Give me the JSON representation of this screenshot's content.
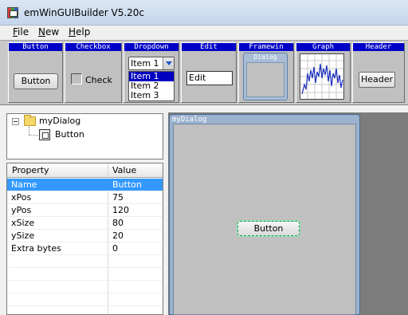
{
  "window": {
    "title": "emWinGUIBuilder V5.20c"
  },
  "menu": [
    {
      "label": "File",
      "accel": "F",
      "rest": "ile"
    },
    {
      "label": "New",
      "accel": "N",
      "rest": "ew"
    },
    {
      "label": "Help",
      "accel": "H",
      "rest": "elp"
    }
  ],
  "toolbar": {
    "button": {
      "title": "Button",
      "sample": "Button"
    },
    "checkbox": {
      "title": "Checkbox",
      "sample": "Check"
    },
    "dropdown": {
      "title": "Dropdown",
      "selected": "Item 1",
      "items": [
        "Item 1",
        "Item 2",
        "Item 3"
      ]
    },
    "edit": {
      "title": "Edit",
      "sample": "Edit"
    },
    "framewin": {
      "title": "Framewin",
      "sample": "Dialog"
    },
    "graph": {
      "title": "Graph"
    },
    "header": {
      "title": "Header",
      "sample": "Header"
    }
  },
  "tree": {
    "root": "myDialog",
    "child": "Button"
  },
  "properties": {
    "columns": [
      "Property",
      "Value"
    ],
    "rows": [
      {
        "name": "Name",
        "value": "Button",
        "selected": true
      },
      {
        "name": "xPos",
        "value": "75"
      },
      {
        "name": "yPos",
        "value": "120"
      },
      {
        "name": "xSize",
        "value": "80"
      },
      {
        "name": "ySize",
        "value": "20"
      },
      {
        "name": "Extra bytes",
        "value": "0"
      }
    ]
  },
  "editor": {
    "dialog_title": "myDialog",
    "button_label": "Button"
  },
  "colors": {
    "toolbar_header": "#0000c8",
    "selection": "#3399ff",
    "editor_bg": "#7c7c7c",
    "dialog_frame": "#9cb3cf"
  }
}
